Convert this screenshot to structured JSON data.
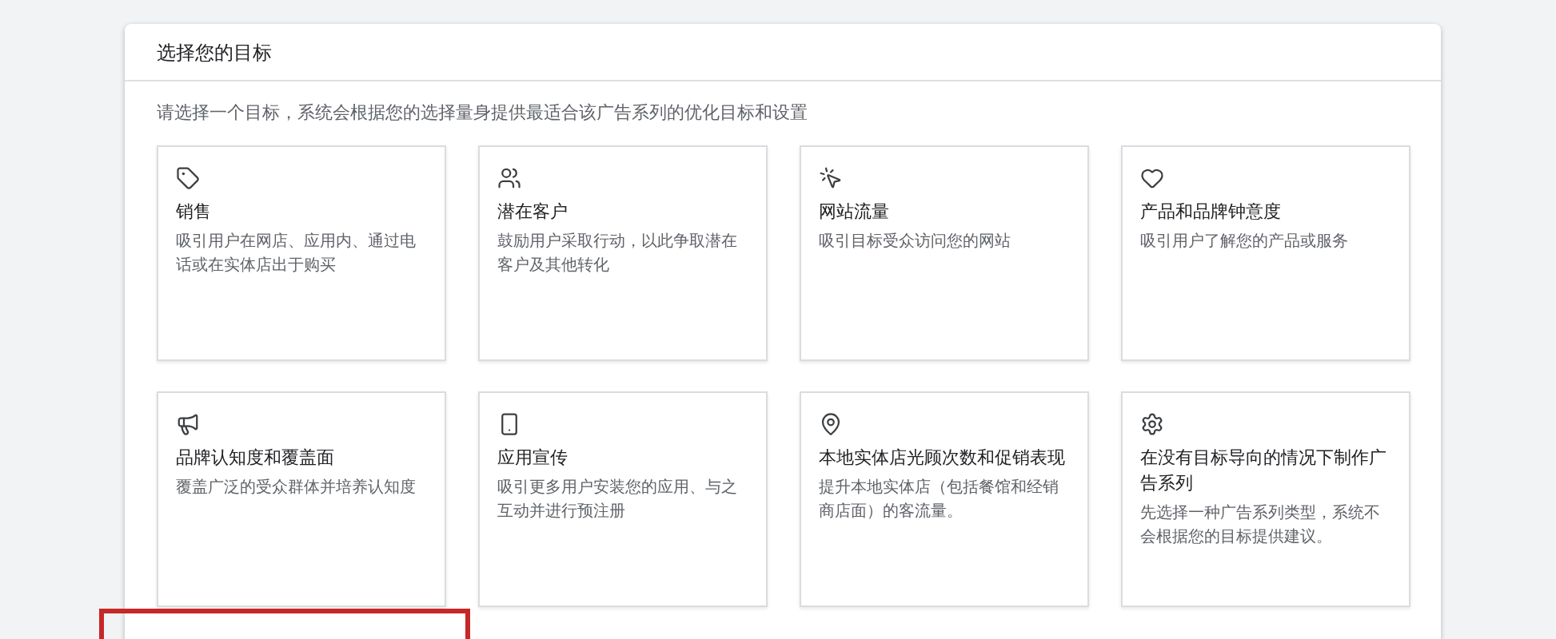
{
  "panel": {
    "title": "选择您的目标",
    "subtitle": "请选择一个目标，系统会根据您的选择量身提供最适合该广告系列的优化目标和设置"
  },
  "goals": [
    {
      "title": "销售",
      "description": "吸引用户在网店、应用内、通过电话或在实体店出于购买"
    },
    {
      "title": "潜在客户",
      "description": "鼓励用户采取行动，以此争取潜在客户及其他转化"
    },
    {
      "title": "网站流量",
      "description": "吸引目标受众访问您的网站"
    },
    {
      "title": "产品和品牌钟意度",
      "description": "吸引用户了解您的产品或服务"
    },
    {
      "title": "品牌认知度和覆盖面",
      "description": "覆盖广泛的受众群体并培养认知度"
    },
    {
      "title": "应用宣传",
      "description": "吸引更多用户安装您的应用、与之互动并进行预注册"
    },
    {
      "title": "本地实体店光顾次数和促销表现",
      "description": "提升本地实体店（包括餐馆和经销商店面）的客流量。"
    },
    {
      "title": "在没有目标导向的情况下制作广告系列",
      "description": "先选择一种广告系列类型，系统不会根据您的目标提供建议。"
    }
  ]
}
